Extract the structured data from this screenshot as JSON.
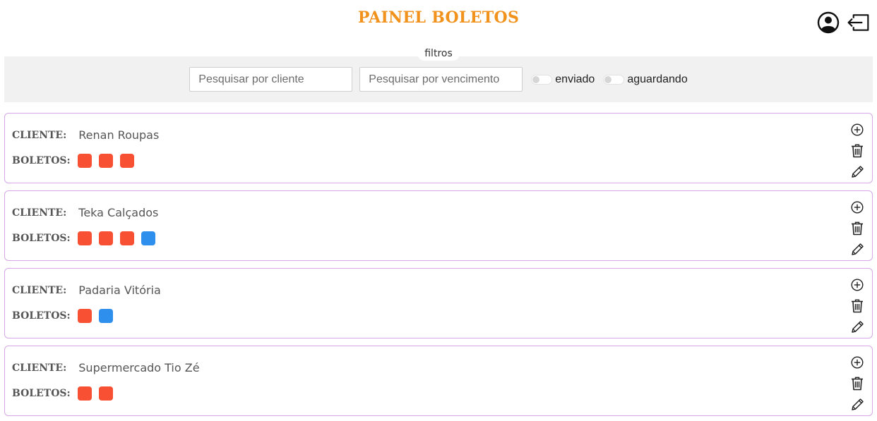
{
  "header": {
    "title": "PAINEL BOLETOS",
    "icons": [
      "user-circle-icon",
      "logout-icon"
    ]
  },
  "filters": {
    "label": "filtros",
    "client_placeholder": "Pesquisar por cliente",
    "due_placeholder": "Pesquisar por vencimento",
    "sent_label": "enviado",
    "waiting_label": "aguardando"
  },
  "labels": {
    "client": "CLIENTE:",
    "boletos": "BOLETOS:"
  },
  "colors": {
    "title": "#f0921c",
    "boleto_red": "#f85032",
    "boleto_blue": "#2f8fec",
    "card_border": "#d6a6e6",
    "filter_bg": "#f1f1f1"
  },
  "clients": [
    {
      "name": "Renan Roupas",
      "boletos": [
        "red",
        "red",
        "red"
      ]
    },
    {
      "name": "Teka Calçados",
      "boletos": [
        "red",
        "red",
        "red",
        "blue"
      ]
    },
    {
      "name": "Padaria Vitória",
      "boletos": [
        "red",
        "blue"
      ]
    },
    {
      "name": "Supermercado Tio Zé",
      "boletos": [
        "red",
        "red"
      ]
    }
  ]
}
